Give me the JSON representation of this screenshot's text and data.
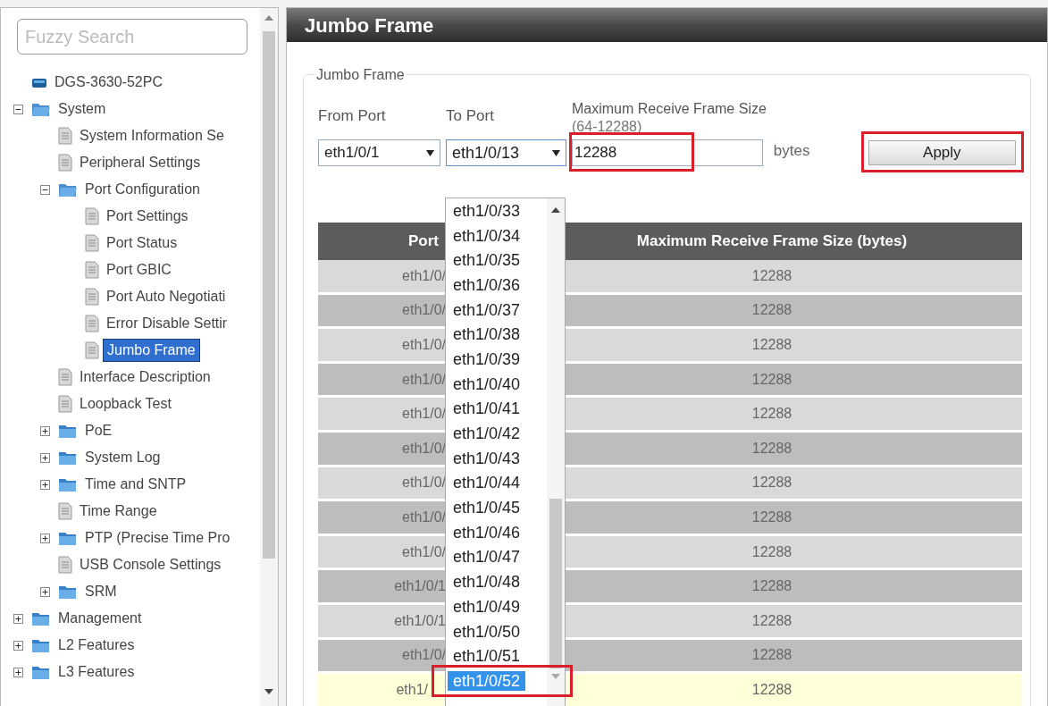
{
  "sidebar": {
    "search": {
      "placeholder": "Fuzzy Search"
    },
    "tree": [
      {
        "label": "DGS-3630-52PC",
        "kind": "device",
        "selected": false
      },
      {
        "label": "System",
        "kind": "folder",
        "expanded": true,
        "selected": false,
        "children": [
          {
            "label": "System Information Se",
            "kind": "page",
            "selected": false
          },
          {
            "label": "Peripheral Settings",
            "kind": "page",
            "selected": false
          },
          {
            "label": "Port Configuration",
            "kind": "folder",
            "expanded": true,
            "selected": false,
            "children": [
              {
                "label": "Port Settings",
                "kind": "page",
                "selected": false
              },
              {
                "label": "Port Status",
                "kind": "page",
                "selected": false
              },
              {
                "label": "Port GBIC",
                "kind": "page",
                "selected": false
              },
              {
                "label": "Port Auto Negotiati",
                "kind": "page",
                "selected": false
              },
              {
                "label": "Error Disable Settir",
                "kind": "page",
                "selected": false
              },
              {
                "label": "Jumbo Frame",
                "kind": "page",
                "selected": true
              }
            ]
          },
          {
            "label": "Interface Description",
            "kind": "page",
            "selected": false
          },
          {
            "label": "Loopback Test",
            "kind": "page",
            "selected": false
          },
          {
            "label": "PoE",
            "kind": "folder",
            "expanded": false,
            "selected": false
          },
          {
            "label": "System Log",
            "kind": "folder",
            "expanded": false,
            "selected": false
          },
          {
            "label": "Time and SNTP",
            "kind": "folder",
            "expanded": false,
            "selected": false
          },
          {
            "label": "Time Range",
            "kind": "page",
            "selected": false
          },
          {
            "label": "PTP (Precise Time Pro",
            "kind": "folder",
            "expanded": false,
            "selected": false
          },
          {
            "label": "USB Console Settings",
            "kind": "page",
            "selected": false
          },
          {
            "label": "SRM",
            "kind": "folder",
            "expanded": false,
            "selected": false
          }
        ]
      },
      {
        "label": "Management",
        "kind": "folder",
        "expanded": false,
        "selected": false
      },
      {
        "label": "L2 Features",
        "kind": "folder",
        "expanded": false,
        "selected": false
      },
      {
        "label": "L3 Features",
        "kind": "folder",
        "expanded": false,
        "selected": false
      }
    ]
  },
  "page_title": "Jumbo Frame",
  "section_title": "Jumbo Frame",
  "form": {
    "from_port": {
      "label": "From Port",
      "value": "eth1/0/1"
    },
    "to_port": {
      "label": "To Port",
      "value": "eth1/0/13",
      "expanded": true,
      "options": [
        {
          "label": "eth1/0/33",
          "selected": false
        },
        {
          "label": "eth1/0/34",
          "selected": false
        },
        {
          "label": "eth1/0/35",
          "selected": false
        },
        {
          "label": "eth1/0/36",
          "selected": false
        },
        {
          "label": "eth1/0/37",
          "selected": false
        },
        {
          "label": "eth1/0/38",
          "selected": false
        },
        {
          "label": "eth1/0/39",
          "selected": false
        },
        {
          "label": "eth1/0/40",
          "selected": false
        },
        {
          "label": "eth1/0/41",
          "selected": false
        },
        {
          "label": "eth1/0/42",
          "selected": false
        },
        {
          "label": "eth1/0/43",
          "selected": false
        },
        {
          "label": "eth1/0/44",
          "selected": false
        },
        {
          "label": "eth1/0/45",
          "selected": false
        },
        {
          "label": "eth1/0/46",
          "selected": false
        },
        {
          "label": "eth1/0/47",
          "selected": false
        },
        {
          "label": "eth1/0/48",
          "selected": false
        },
        {
          "label": "eth1/0/49",
          "selected": false
        },
        {
          "label": "eth1/0/50",
          "selected": false
        },
        {
          "label": "eth1/0/51",
          "selected": false
        },
        {
          "label": "eth1/0/52",
          "selected": true,
          "highlighted": true
        }
      ]
    },
    "size": {
      "label": "Maximum Receive Frame Size",
      "range": "(64-12288)",
      "value": "12288",
      "unit": "bytes",
      "highlighted": true
    },
    "apply": {
      "label": "Apply",
      "highlighted": true
    }
  },
  "table": {
    "columns": [
      "Port",
      "Maximum Receive Frame Size (bytes)"
    ],
    "rows": [
      {
        "port": "eth1/0/",
        "size": "12288",
        "highlighted": false
      },
      {
        "port": "eth1/0/",
        "size": "12288",
        "highlighted": false
      },
      {
        "port": "eth1/0/",
        "size": "12288",
        "highlighted": false
      },
      {
        "port": "eth1/0/",
        "size": "12288",
        "highlighted": false
      },
      {
        "port": "eth1/0/",
        "size": "12288",
        "highlighted": false
      },
      {
        "port": "eth1/0/",
        "size": "12288",
        "highlighted": false
      },
      {
        "port": "eth1/0/",
        "size": "12288",
        "highlighted": false
      },
      {
        "port": "eth1/0/",
        "size": "12288",
        "highlighted": false
      },
      {
        "port": "eth1/0/",
        "size": "12288",
        "highlighted": false
      },
      {
        "port": "eth1/0/1",
        "size": "12288",
        "highlighted": false
      },
      {
        "port": "eth1/0/1",
        "size": "12288",
        "highlighted": false
      },
      {
        "port": "eth1/0/",
        "size": "12288",
        "highlighted": false
      },
      {
        "port": "eth1/",
        "size": "12288",
        "highlighted": true
      }
    ]
  }
}
